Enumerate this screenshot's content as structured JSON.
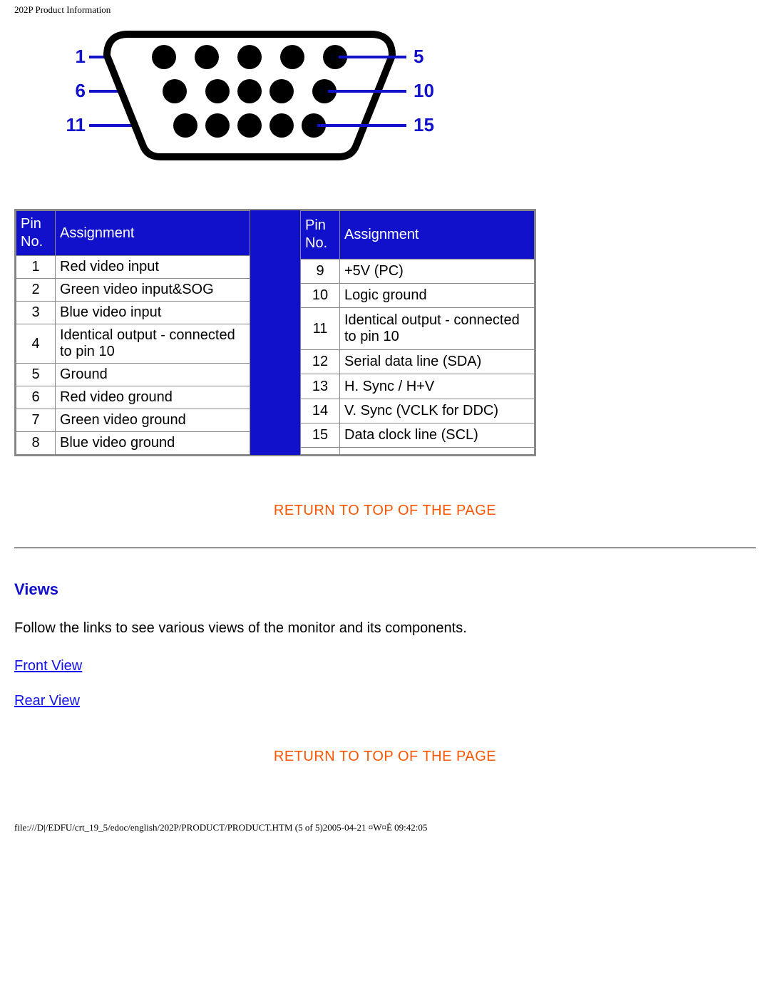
{
  "meta": {
    "header": "202P Product Information",
    "footer": "file:///D|/EDFU/crt_19_5/edoc/english/202P/PRODUCT/PRODUCT.HTM (5 of 5)2005-04-21 ¤W¤È 09:42:05"
  },
  "diagram": {
    "row_start_labels": [
      "1",
      "6",
      "11"
    ],
    "row_end_labels": [
      "5",
      "10",
      "15"
    ]
  },
  "table": {
    "headers": {
      "pin": "Pin No.",
      "assign": "Assignment"
    },
    "left": [
      {
        "pin": "1",
        "assign": "Red video input"
      },
      {
        "pin": "2",
        "assign": "Green video input&SOG"
      },
      {
        "pin": "3",
        "assign": "Blue video input"
      },
      {
        "pin": "4",
        "assign": "Identical output - connected to pin 10"
      },
      {
        "pin": "5",
        "assign": "Ground"
      },
      {
        "pin": "6",
        "assign": "Red video ground"
      },
      {
        "pin": "7",
        "assign": "Green video ground"
      },
      {
        "pin": "8",
        "assign": "Blue video ground"
      }
    ],
    "right": [
      {
        "pin": "9",
        "assign": "+5V (PC)"
      },
      {
        "pin": "10",
        "assign": "Logic ground"
      },
      {
        "pin": "11",
        "assign": "Identical output - connected to pin 10"
      },
      {
        "pin": "12",
        "assign": "Serial data line (SDA)"
      },
      {
        "pin": "13",
        "assign": "H. Sync / H+V"
      },
      {
        "pin": "14",
        "assign": "V. Sync (VCLK for DDC)"
      },
      {
        "pin": "15",
        "assign": "Data clock line (SCL)"
      },
      {
        "pin": "",
        "assign": ""
      }
    ]
  },
  "links": {
    "return_top": "RETURN TO TOP OF THE PAGE",
    "front": "Front View",
    "rear": "Rear View"
  },
  "views": {
    "heading": "Views",
    "body": "Follow the links to see various views of the monitor and its components."
  }
}
